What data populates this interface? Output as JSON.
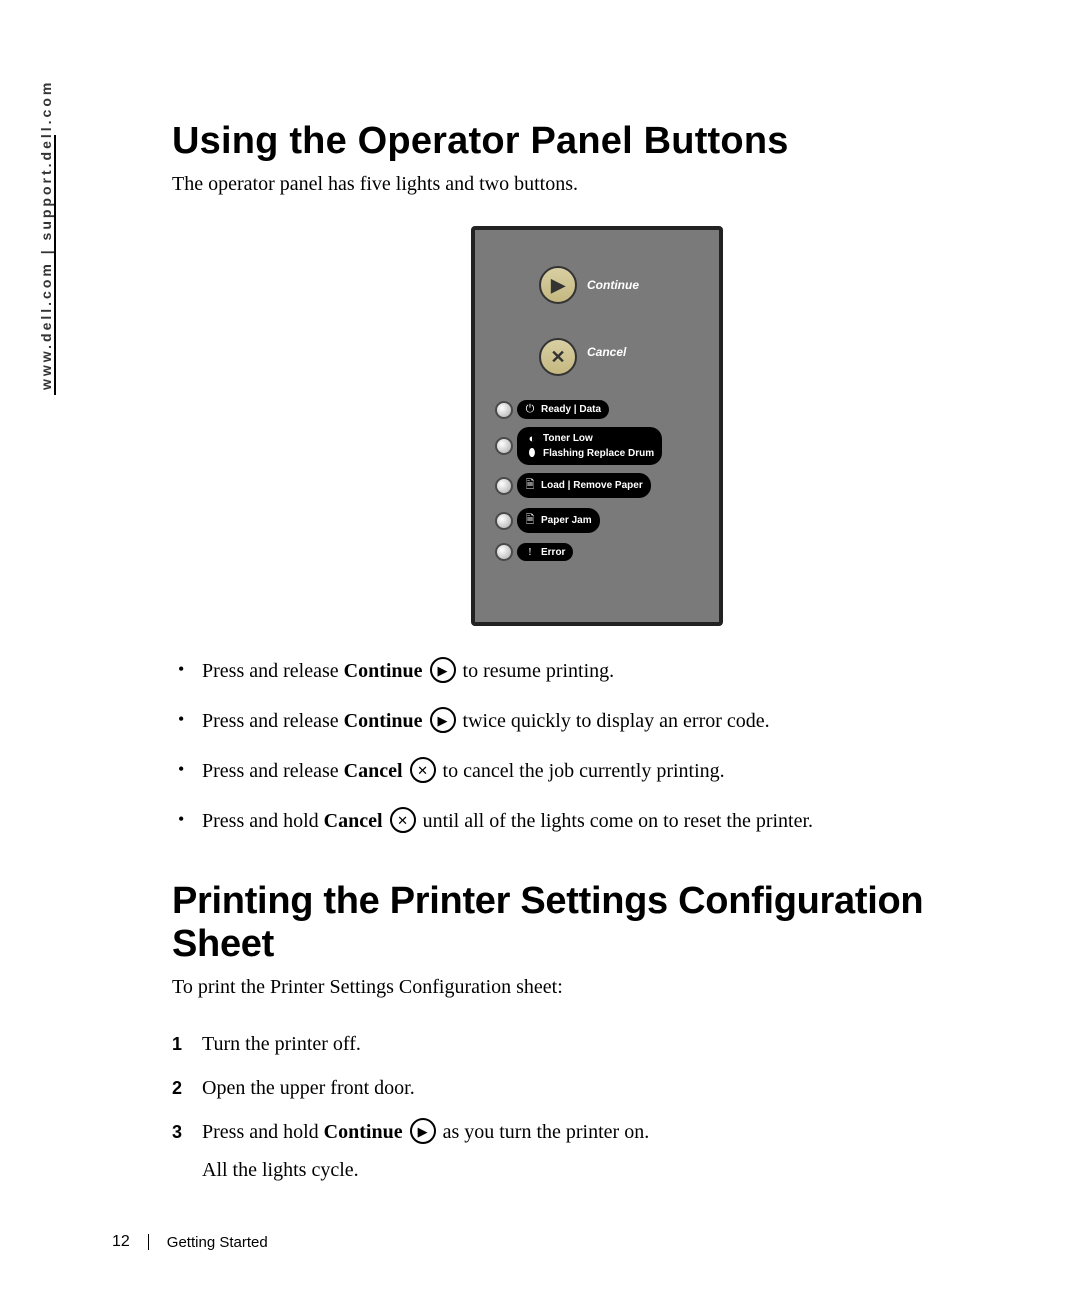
{
  "sidebar": {
    "url": "www.dell.com | support.dell.com"
  },
  "section1": {
    "title": "Using the Operator Panel Buttons",
    "lead": "The operator panel has five lights and two buttons."
  },
  "panel": {
    "continue_label": "Continue",
    "cancel_label": "Cancel",
    "lights": {
      "ready": "Ready | Data",
      "toner_low": "Toner Low",
      "flashing_drum": "Flashing Replace Drum",
      "load_paper": "Load | Remove Paper",
      "paper_jam": "Paper Jam",
      "error": "Error"
    }
  },
  "bullets": {
    "b1_pre": "Press and release ",
    "b1_bold": "Continue",
    "b1_post": " to resume printing.",
    "b2_pre": "Press and release ",
    "b2_bold": "Continue",
    "b2_post": " twice quickly to display an error code.",
    "b3_pre": "Press and release ",
    "b3_bold": "Cancel",
    "b3_post": " to cancel the job currently printing.",
    "b4_pre": "Press and hold ",
    "b4_bold": "Cancel",
    "b4_post": " until all of the lights come on to reset the printer."
  },
  "section2": {
    "title": "Printing the Printer Settings Configuration Sheet",
    "lead": "To print the Printer Settings Configuration sheet:"
  },
  "steps": {
    "s1": "Turn the printer off.",
    "s2": "Open the upper front door.",
    "s3_pre": "Press and hold ",
    "s3_bold": "Continue",
    "s3_post": " as you turn the printer on.",
    "s3_sub": "All the lights cycle."
  },
  "footer": {
    "page": "12",
    "chapter": "Getting Started"
  }
}
